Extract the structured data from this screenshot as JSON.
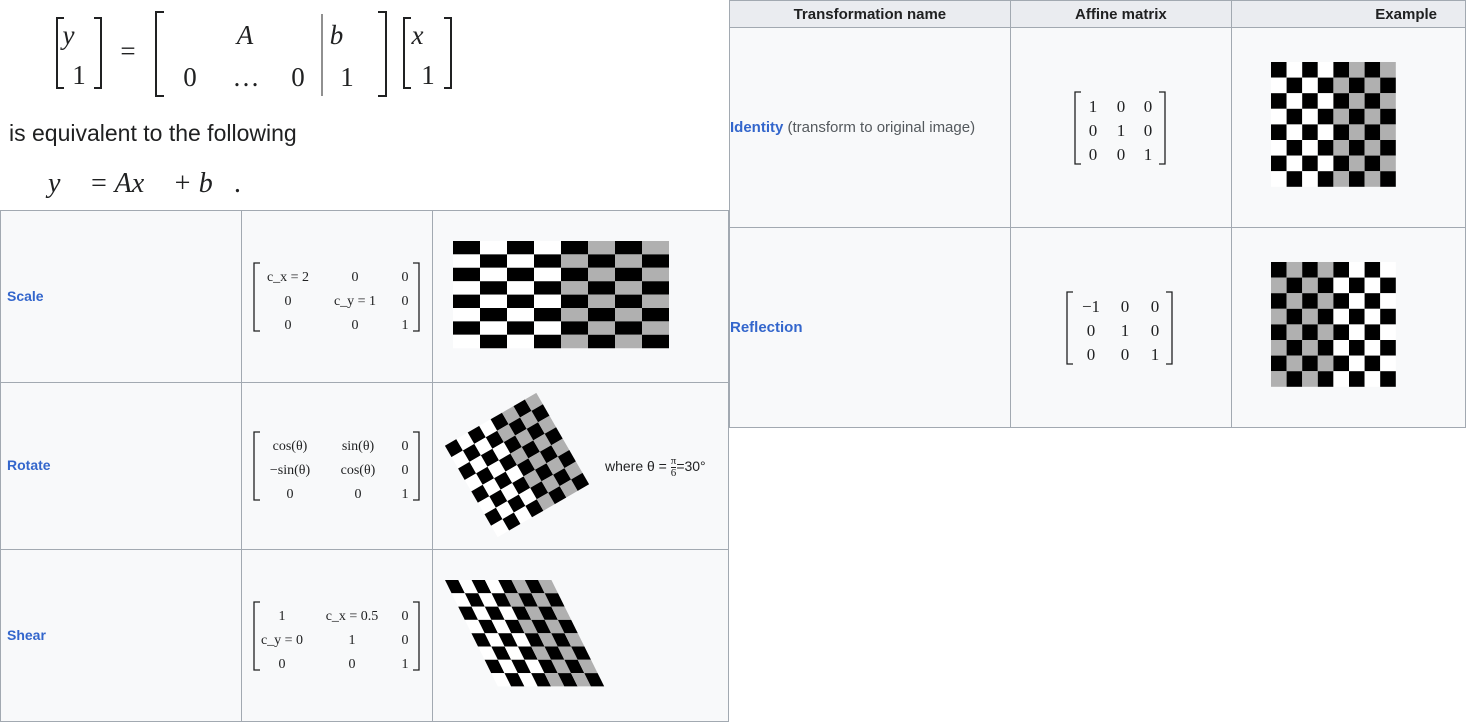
{
  "equation": {
    "lhs_top": "y⃗",
    "lhs_bottom": "1",
    "eq": "=",
    "A": "A",
    "zero_left": "0",
    "dots": "…",
    "zero_right": "0",
    "b": "b⃗",
    "one": "1",
    "x": "x⃗",
    "x_bottom": "1"
  },
  "equiv_text": "is equivalent to the following",
  "equation2": "y⃗ = Ax⃗ + b⃗.",
  "left_table": {
    "rows": [
      {
        "name": "Scale",
        "matrix": [
          [
            "c_x = 2",
            "0",
            "0"
          ],
          [
            "0",
            "c_y = 1",
            "0"
          ],
          [
            "0",
            "0",
            "1"
          ]
        ],
        "example": "stretched-checkerboard"
      },
      {
        "name": "Rotate",
        "matrix": [
          [
            "cos(θ)",
            "sin(θ)",
            "0"
          ],
          [
            "−sin(θ)",
            "cos(θ)",
            "0"
          ],
          [
            "0",
            "0",
            "1"
          ]
        ],
        "example": "rotated-checkerboard",
        "where_prefix": "where θ = ",
        "where_frac_num": "π",
        "where_frac_den": "6",
        "where_suffix": "=30°"
      },
      {
        "name": "Shear",
        "matrix": [
          [
            "1",
            "c_x = 0.5",
            "0"
          ],
          [
            "c_y = 0",
            "1",
            "0"
          ],
          [
            "0",
            "0",
            "1"
          ]
        ],
        "example": "sheared-checkerboard"
      }
    ]
  },
  "right_table": {
    "headers": [
      "Transformation name",
      "Affine matrix",
      "Example"
    ],
    "rows": [
      {
        "name": "Identity",
        "note": "(transform to original image)",
        "matrix": [
          [
            "1",
            "0",
            "0"
          ],
          [
            "0",
            "1",
            "0"
          ],
          [
            "0",
            "0",
            "1"
          ]
        ],
        "example": "identity-checkerboard"
      },
      {
        "name": "Reflection",
        "note": "",
        "matrix": [
          [
            "−1",
            "0",
            "0"
          ],
          [
            "0",
            "1",
            "0"
          ],
          [
            "0",
            "0",
            "1"
          ]
        ],
        "example": "reflected-checkerboard"
      }
    ]
  },
  "colors": {
    "link": "#3366cc",
    "border": "#a2a9b1",
    "header_bg": "#eaecf0",
    "cell_bg": "#f8f9fa",
    "square_dark": "#000000",
    "square_gray": "#b0b0b0",
    "square_light": "#ffffff"
  }
}
